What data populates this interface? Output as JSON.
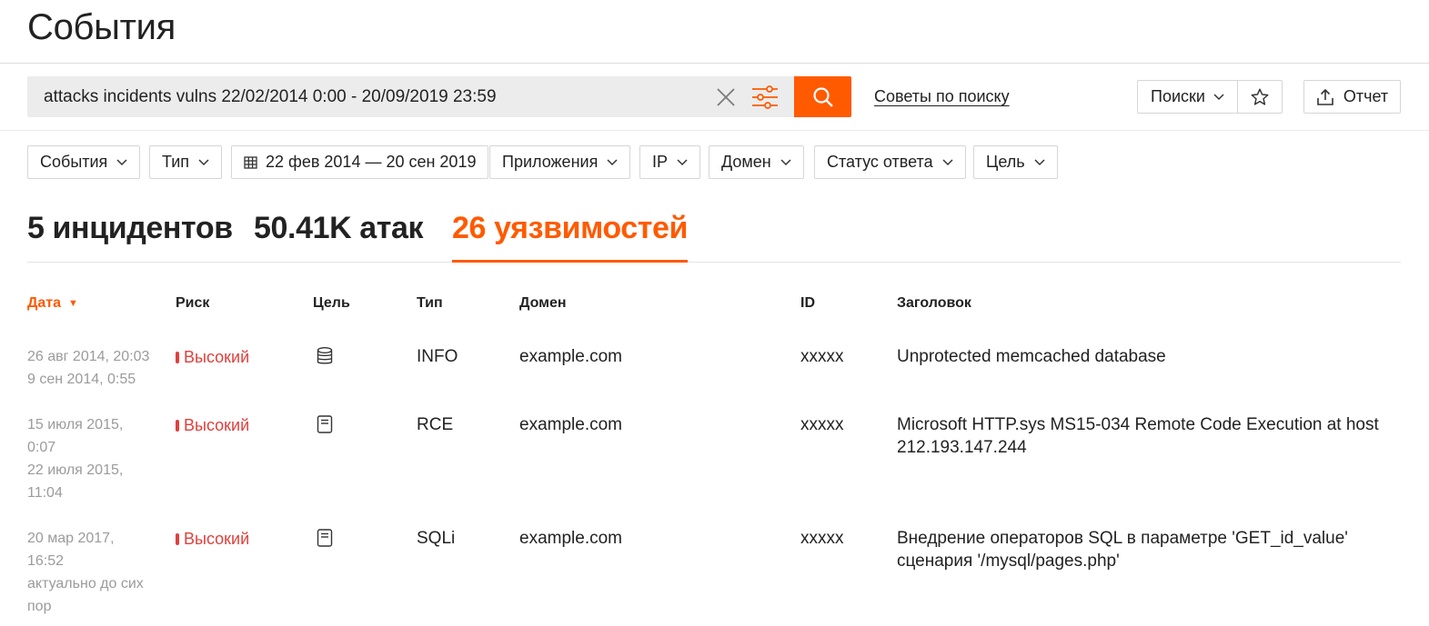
{
  "page": {
    "title": "События"
  },
  "search": {
    "query": "attacks incidents vulns 22/02/2014 0:00 - 20/09/2019 23:59",
    "tips_label": "Советы по поиску",
    "saved_searches_label": "Поиски",
    "report_label": "Отчет"
  },
  "filters": [
    {
      "label": "События"
    },
    {
      "label": "Тип"
    },
    {
      "label": "22 фев 2014 — 20 сен 2019",
      "icon": "calendar-icon"
    },
    {
      "label": "Приложения"
    },
    {
      "label": "IP"
    },
    {
      "label": "Домен"
    },
    {
      "label": "Статус ответа"
    },
    {
      "label": "Цель"
    }
  ],
  "tabs": [
    {
      "label": "5 инцидентов",
      "active": false
    },
    {
      "label": "50.41K атак",
      "active": false
    },
    {
      "label": "26 уязвимостей",
      "active": true
    }
  ],
  "table": {
    "columns": {
      "date": "Дата",
      "risk": "Риск",
      "target": "Цель",
      "type": "Тип",
      "domain": "Домен",
      "id": "ID",
      "title": "Заголовок"
    },
    "sort_indicator": "▼",
    "rows": [
      {
        "date_lines": [
          "26 авг 2014, 20:03",
          "9 сен 2014, 0:55"
        ],
        "risk": "Высокий",
        "target_icon": "database-icon",
        "type": "INFO",
        "domain": "example.com",
        "id": "xxxxx",
        "title": "Unprotected memcached database"
      },
      {
        "date_lines": [
          "15 июля 2015,",
          "0:07",
          "22 июля 2015,",
          "11:04"
        ],
        "risk": "Высокий",
        "target_icon": "server-icon",
        "type": "RCE",
        "domain": "example.com",
        "id": "xxxxx",
        "title": "Microsoft HTTP.sys MS15-034 Remote Code Execution at host 212.193.147.244"
      },
      {
        "date_lines": [
          "20 мар 2017,",
          "16:52",
          "актуально до сих",
          "пор"
        ],
        "risk": "Высокий",
        "target_icon": "server-icon",
        "type": "SQLi",
        "domain": "example.com",
        "id": "xxxxx",
        "title": "Внедрение операторов SQL в параметре 'GET_id_value' сценария '/mysql/pages.php'"
      }
    ]
  },
  "colors": {
    "accent": "#ff5a00",
    "risk_high": "#e0403d",
    "muted": "#9b9b9b"
  }
}
